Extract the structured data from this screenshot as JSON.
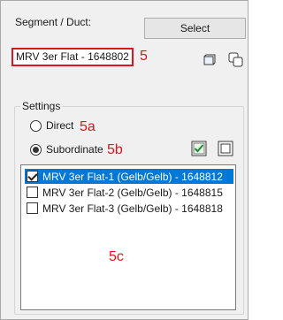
{
  "segment": {
    "label": "Segment / Duct:",
    "select_button": "Select",
    "value": "MRV 3er Flat - 1648802"
  },
  "annotations": {
    "a5": "5",
    "a5a": "5a",
    "a5b": "5b",
    "a5c": "5c"
  },
  "settings": {
    "title": "Settings",
    "radio_direct": {
      "label": "Direct",
      "checked": false
    },
    "radio_subordinate": {
      "label": "Subordinate",
      "checked": true
    }
  },
  "list": {
    "items": [
      {
        "label": "MRV 3er Flat-1 (Gelb/Gelb) - 1648812",
        "checked": true,
        "selected": true
      },
      {
        "label": "MRV 3er Flat-2 (Gelb/Gelb) - 1648815",
        "checked": false,
        "selected": false
      },
      {
        "label": "MRV 3er Flat-3 (Gelb/Gelb) - 1648818",
        "checked": false,
        "selected": false
      }
    ]
  },
  "icons": {
    "copy_single": "square-outline-icon",
    "copy_multi": "stacked-squares-icon",
    "check_all": "check-all-icon",
    "uncheck_all": "uncheck-all-icon"
  },
  "colors": {
    "annotation": "#e0141e",
    "selection": "#0078d7"
  }
}
